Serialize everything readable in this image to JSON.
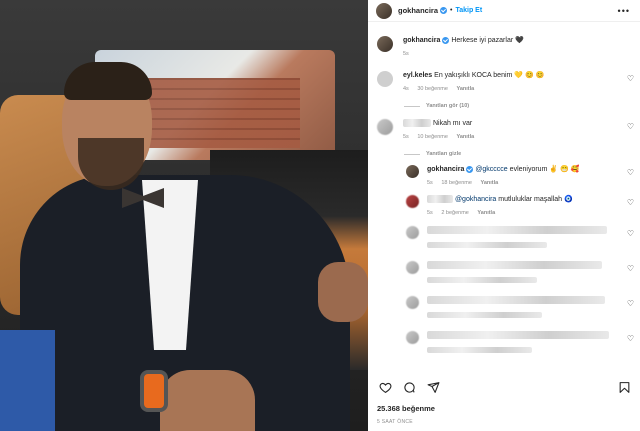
{
  "post": {
    "author": "gokhancira",
    "follow_label": "Takip Et",
    "more_label": "•••",
    "caption": "Herkese iyi pazarlar",
    "caption_emoji": "🖤",
    "caption_time": "5s"
  },
  "comments": [
    {
      "user": "eyl.keles",
      "text": "En yakışıklı KOCA benim 💛 😊 😊",
      "time": "4s",
      "likes": "30 beğenme",
      "reply": "Yanıtla",
      "view_replies": "Yanıtları gör (10)"
    },
    {
      "user": "",
      "text": "Nikah mı var",
      "time": "5s",
      "likes": "10 beğenme",
      "reply": "Yanıtla",
      "view_replies": "Yanıtları gizle",
      "replies": [
        {
          "user": "gokhancira",
          "mention": "@gkcccce",
          "text": "evleniyorum ✌️ 😁 🥰",
          "time": "5s",
          "likes": "18 beğenme",
          "reply": "Yanıtla"
        },
        {
          "user": "",
          "mention": "@gokhancira",
          "text": "mutluluklar maşallah 🧿",
          "time": "5s",
          "likes": "2 beğenme",
          "reply": "Yanıtla"
        }
      ]
    }
  ],
  "footer": {
    "likes": "25.368 beğenme",
    "time": "5 SAAT ÖNCE"
  },
  "icons": [
    "heart-icon",
    "comment-icon",
    "share-icon",
    "bookmark-icon",
    "verified-icon",
    "more-icon"
  ],
  "colors": {
    "link": "#0095f6",
    "verified": "#3897f0",
    "muted": "#8e8e8e"
  }
}
